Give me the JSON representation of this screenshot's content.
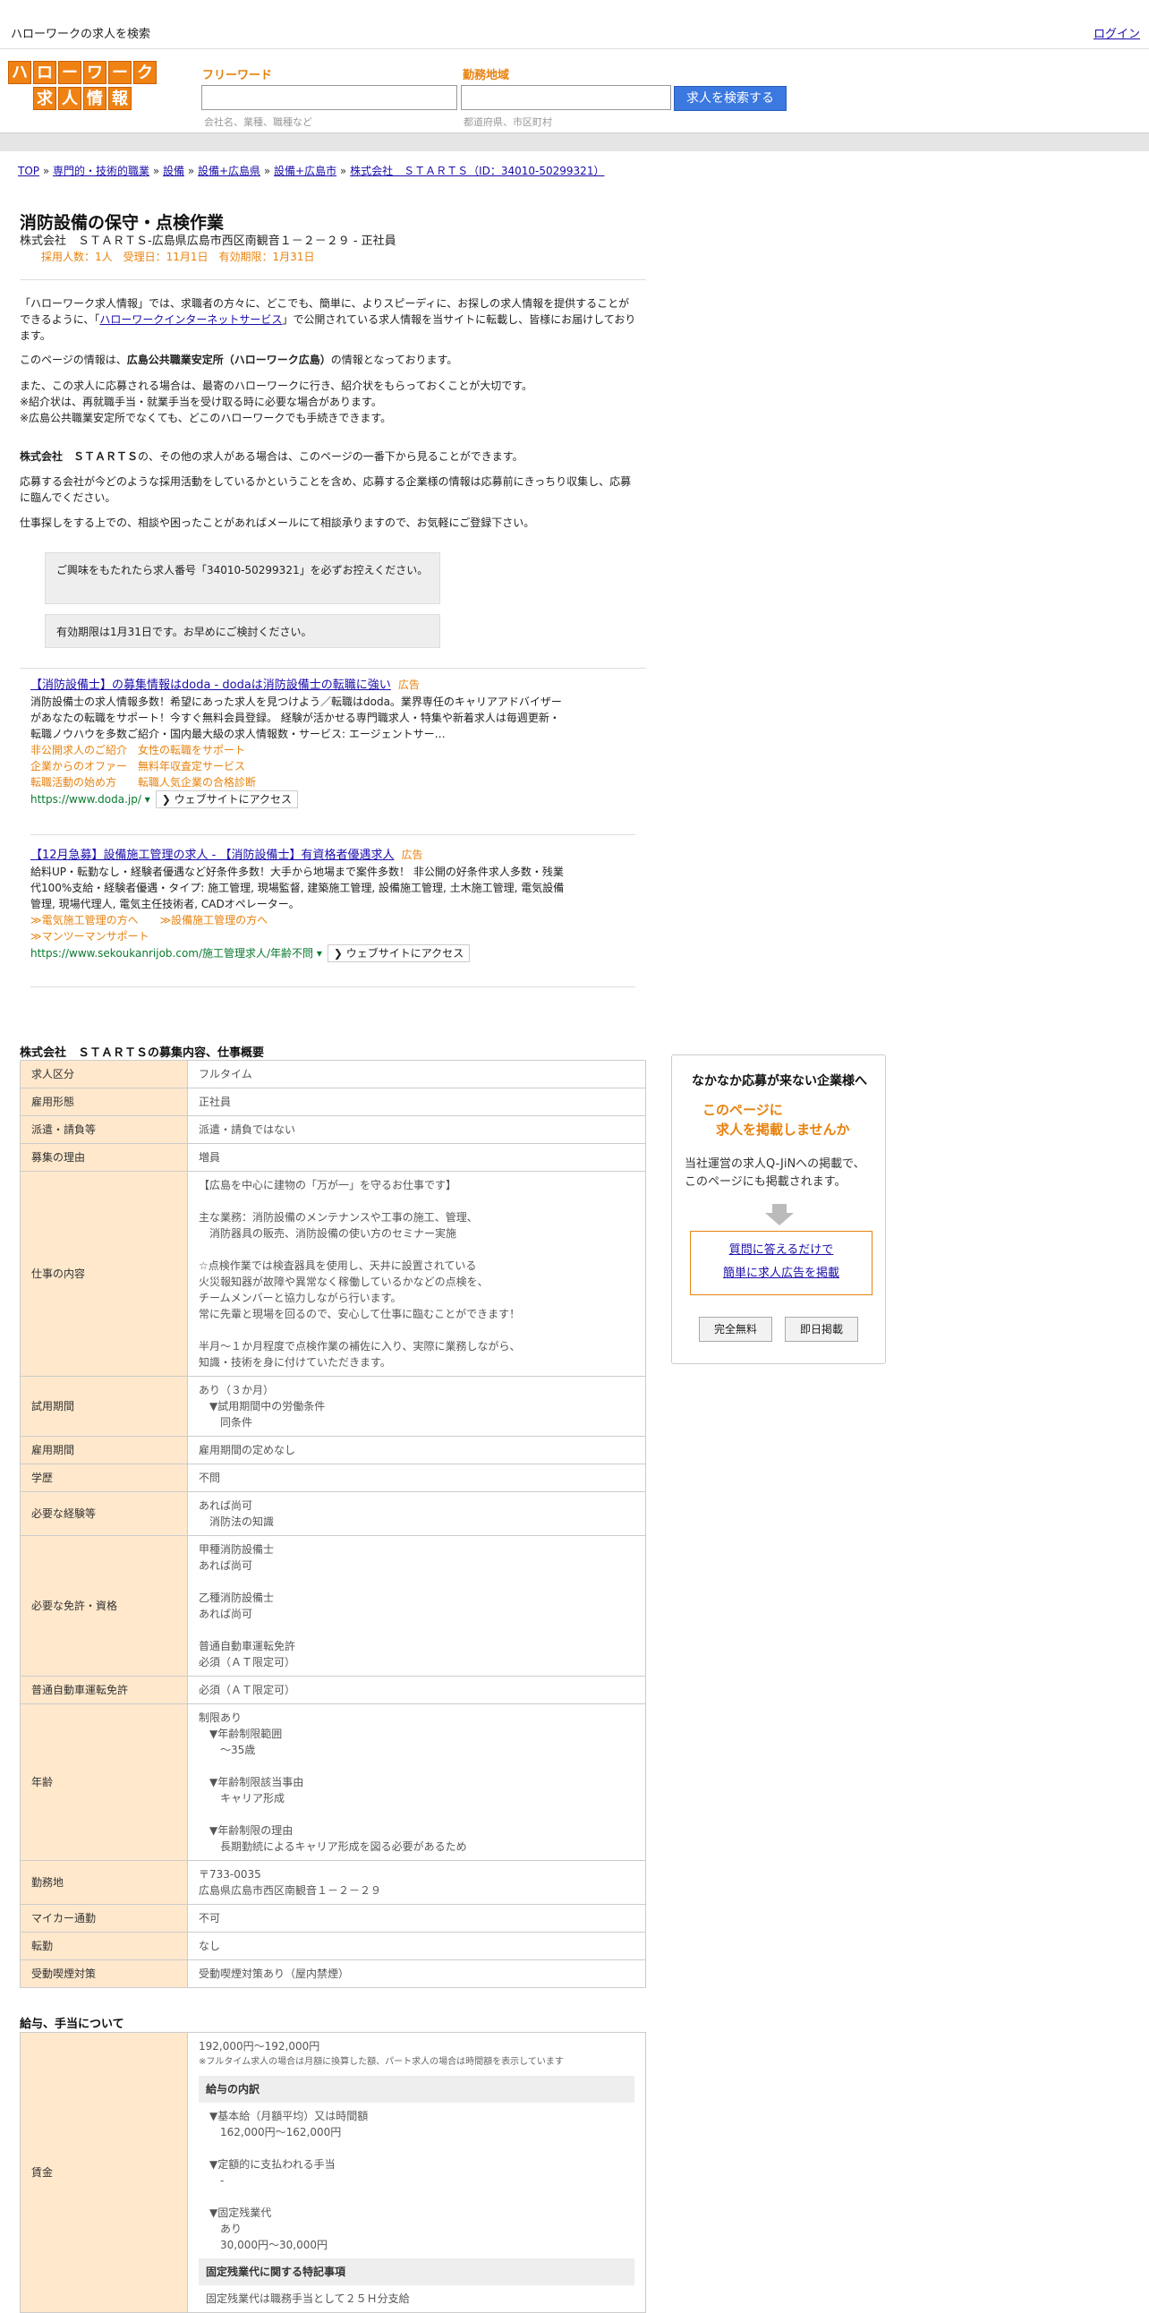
{
  "topbar": {
    "title": "ハローワークの求人を検索",
    "login": "ログイン"
  },
  "logo": {
    "row1": [
      "ハ",
      "ロ",
      "ー",
      "ワ",
      "ー",
      "ク"
    ],
    "row2": [
      "求",
      "人",
      "情",
      "報"
    ]
  },
  "search": {
    "free_label": "フリーワード",
    "free_placeholder": "会社名、業種、職種など",
    "area_label": "勤務地域",
    "area_placeholder": "都道府県、市区町村",
    "button": "求人を検索する"
  },
  "breadcrumb": [
    "TOP",
    "専門的・技術的職業",
    "設備",
    "設備+広島県",
    "設備+広島市",
    "株式会社　ＳＴＡＲＴＳ（ID：34010-50299321）"
  ],
  "job": {
    "title": "消防設備の保守・点検作業",
    "company_line": "株式会社　ＳＴＡＲＴＳ-広島県広島市西区南観音１－２－２９ - 正社員",
    "meta": "採用人数：1人　受理日：11月1日　有効期限：1月31日"
  },
  "intro": {
    "p1a": "「ハローワーク求人情報」では、求職者の方々に、どこでも、簡単に、よりスピーディに、お探しの求人情報を提供することができるように、「",
    "p1link": "ハローワークインターネットサービス",
    "p1b": "」で公開されている求人情報を当サイトに転載し、皆様にお届けしております。",
    "p2a": "このページの情報は、",
    "p2b": "広島公共職業安定所（ハローワーク広島）",
    "p2c": "の情報となっております。",
    "p3": "また、この求人に応募される場合は、最寄のハローワークに行き、紹介状をもらっておくことが大切です。\n※紹介状は、再就職手当・就業手当を受け取る時に必要な場合があります。\n※広島公共職業安定所でなくても、どこのハローワークでも手続きできます。",
    "p4a": "株式会社　ＳＴＡＲＴＳ",
    "p4b": "の、その他の求人がある場合は、このページの一番下から見ることができます。",
    "p5": "応募する会社が今どのような採用活動をしているかということを含め、応募する企業様の情報は応募前にきっちり収集し、応募に臨んでください。",
    "p6": "仕事探しをする上での、相談や困ったことがあればメールにて相談承りますので、お気軽にご登録下さい。",
    "notice1": "ご興味をもたれたら求人番号「34010-50299321」を必ずお控えください。",
    "notice2": "有効期限は1月31日です。お早めにご検討ください。"
  },
  "ads": [
    {
      "title": "【消防設備士】の募集情報はdoda - dodaは消防設備士の転職に強い",
      "tag": "広告",
      "desc": "消防設備士の求人情報多数！希望にあった求人を見つけよう／転職はdoda。業界専任のキャリアアドバイザーがあなたの転職をサポート！今すぐ無料会員登録。 経験が活かせる専門職求人・特集や新着求人は毎週更新・転職ノウハウを多数ご紹介・国内最大級の求人情報数・サービス: エージェントサー…",
      "links": [
        "非公開求人のご紹介　女性の転職をサポート",
        "企業からのオファー　無料年収査定サービス",
        "転職活動の始め方　　転職人気企業の合格診断"
      ],
      "url": "https://www.doda.jp/",
      "button": "ウェブサイトにアクセス"
    },
    {
      "title": "【12月急募】設備施工管理の求人 - 【消防設備士】有資格者優遇求人",
      "tag": "広告",
      "desc": "給料UP・転勤なし・経験者優遇など好条件多数！大手から地場まで案件多数！ 非公開の好条件求人多数・残業代100%支給・経験者優遇・タイプ: 施工管理, 現場監督, 建築施工管理, 設備施工管理, 土木施工管理, 電気設備管理, 現場代理人, 電気主任技術者, CADオペレーター。",
      "links": [
        "≫電気施工管理の方へ　　≫設備施工管理の方へ",
        "≫マンツーマンサポート"
      ],
      "url": "https://www.sekoukanrijob.com/施工管理求人/年齢不問",
      "button": "ウェブサイトにアクセス"
    }
  ],
  "overview": {
    "title": "株式会社　ＳＴＡＲＴＳの募集内容、仕事概要",
    "rows": [
      {
        "k": "求人区分",
        "v": "フルタイム"
      },
      {
        "k": "雇用形態",
        "v": "正社員"
      },
      {
        "k": "派遣・請負等",
        "v": "派遣・請負ではない"
      },
      {
        "k": "募集の理由",
        "v": "増員"
      },
      {
        "k": "仕事の内容",
        "v": "【広島を中心に建物の「万が一」を守るお仕事です】\n\n主な業務：消防設備のメンテナンスや工事の施工、管理、\n　消防器具の販売、消防設備の使い方のセミナー実施\n\n☆点検作業では検査器具を使用し、天井に設置されている\n火災報知器が故障や異常なく稼働しているかなどの点検を、\nチームメンバーと協力しながら行います。\n常に先輩と現場を回るので、安心して仕事に臨むことができます！\n\n半月～１か月程度で点検作業の補佐に入り、実際に業務しながら、\n知識・技術を身に付けていただきます。"
      },
      {
        "k": "試用期間",
        "v": "あり（３か月）\n　▼試用期間中の労働条件\n　　同条件"
      },
      {
        "k": "雇用期間",
        "v": "雇用期間の定めなし"
      },
      {
        "k": "学歴",
        "v": "不問"
      },
      {
        "k": "必要な経験等",
        "v": "あれば尚可\n　消防法の知識"
      },
      {
        "k": "必要な免許・資格",
        "v": "甲種消防設備士\nあれば尚可\n\n乙種消防設備士\nあれば尚可\n\n普通自動車運転免許\n必須（ＡＴ限定可）"
      },
      {
        "k": "普通自動車運転免許",
        "v": "必須（ＡＴ限定可）"
      },
      {
        "k": "年齢",
        "v": "制限あり\n　▼年齢制限範囲\n　　〜35歳\n\n　▼年齢制限該当事由\n　　キャリア形成\n\n　▼年齢制限の理由\n　　長期勤続によるキャリア形成を図る必要があるため"
      },
      {
        "k": "勤務地",
        "v": "〒733-0035\n広島県広島市西区南観音１－２－２９"
      },
      {
        "k": "マイカー通勤",
        "v": "不可"
      },
      {
        "k": "転勤",
        "v": "なし"
      },
      {
        "k": "受動喫煙対策",
        "v": "受動喫煙対策あり（屋内禁煙）"
      }
    ]
  },
  "salary": {
    "title": "給与、手当について",
    "key": "賃金",
    "range": "192,000円〜192,000円",
    "note": "※フルタイム求人の場合は月額に換算した額、パート求人の場合は時間額を表示しています",
    "breakdown_title": "給与の内訳",
    "breakdown": "▼基本給（月額平均）又は時間額\n　162,000円〜162,000円\n\n▼定額的に支払われる手当\n　-\n\n▼固定残業代\n　あり\n　30,000円〜30,000円",
    "special_title": "固定残業代に関する特記事項",
    "special": "固定残業代は職務手当として２５Ｈ分支給"
  },
  "sidebar": {
    "title": "なかなか応募が来ない企業様へ",
    "headline": "このページに\n　求人を掲載しませんか",
    "body": "当社運営の求人Q-JiNへの掲載で、\nこのページにも掲載されます。",
    "link1": "質問に答えるだけで",
    "link2": "簡単に求人広告を掲載",
    "btn1": "完全無料",
    "btn2": "即日掲載"
  }
}
